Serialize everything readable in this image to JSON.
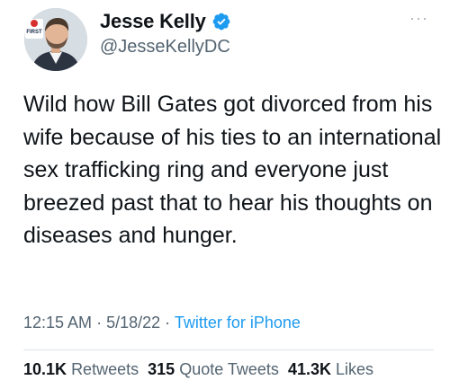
{
  "author": {
    "display_name": "Jesse Kelly",
    "handle": "@JesseKellyDC",
    "verified": true,
    "avatar_badge_text": "FIRST"
  },
  "tweet": {
    "text": "Wild how Bill Gates got divorced from his wife because of his ties to an international sex trafficking ring and everyone just breezed past that to hear his thoughts on diseases and hunger.",
    "time": "12:15 AM",
    "separator": "·",
    "date": "5/18/22",
    "source": "Twitter for iPhone"
  },
  "stats": {
    "retweets_count": "10.1K",
    "retweets_label": "Retweets",
    "quotes_count": "315",
    "quotes_label": "Quote Tweets",
    "likes_count": "41.3K",
    "likes_label": "Likes"
  },
  "menu": {
    "more_label": "···"
  },
  "colors": {
    "accent": "#1d9bf0",
    "text": "#0f1419",
    "muted": "#536471",
    "divider": "#dfe4e8"
  }
}
